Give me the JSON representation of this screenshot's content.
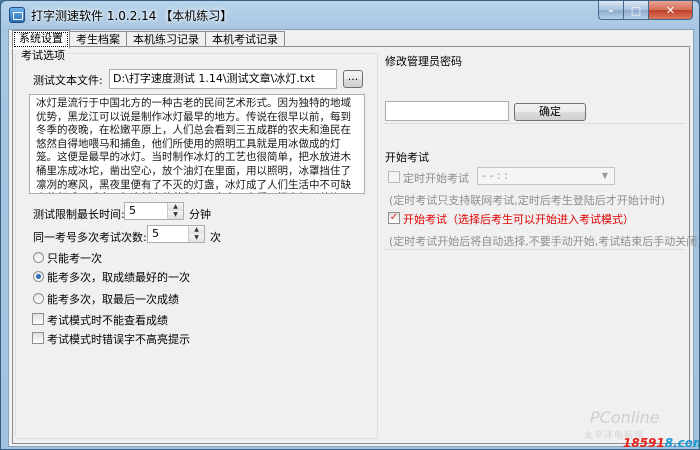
{
  "window": {
    "title": "打字测速软件  1.0.2.14 【本机练习】",
    "minimize": "–",
    "maximize": "□",
    "close": "✕",
    "icon": "app-keyboard-icon"
  },
  "tabs": [
    {
      "label": "系统设置",
      "active": true
    },
    {
      "label": "考生档案",
      "active": false
    },
    {
      "label": "本机练习记录",
      "active": false
    },
    {
      "label": "本机考试记录",
      "active": false
    }
  ],
  "exam_options": {
    "group_title": "考试选项",
    "file_label": "测试文本文件:",
    "file_value": "D:\\打字速度测试 1.14\\测试文章\\冰灯.txt",
    "browse_label": "...",
    "article_text": "冰灯是流行于中国北方的一种古老的民间艺术形式。因为独特的地域优势，黑龙江可以说是制作冰灯最早的地方。传说在很早以前，每到冬季的夜晚，在松嫩平原上，人们总会看到三五成群的农夫和渔民在悠然自得地喂马和捕鱼，他们所使用的照明工具就是用冰做成的灯笼。这便是最早的冰灯。当时制作冰灯的工艺也很简单，把水放进木桶里冻成冰坨，凿出空心，放个油灯在里面，用以照明，冰罩挡住了凛冽的寒风，黑夜里便有了不灭的灯盏，冰灯成了人们生活中不可缺少的帮手。后来，每逢新春佳节和上元之夜，人们又把它加以装饰，而成为供人观赏的独特的艺术表现形",
    "time_limit_label": "测试限制最长时间:",
    "time_limit_value": "5",
    "time_limit_unit": "分钟",
    "retry_label": "同一考号多次考试次数:",
    "retry_value": "5",
    "retry_unit": "次",
    "radio_options": [
      {
        "label": "只能考一次",
        "checked": false
      },
      {
        "label": "能考多次，取成绩最好的一次",
        "checked": true
      },
      {
        "label": "能考多次，取最后一次成绩",
        "checked": false
      }
    ],
    "checkboxes": [
      {
        "label": "考试模式时不能查看成绩",
        "checked": false
      },
      {
        "label": "考试模式时错误字不高亮提示",
        "checked": false
      }
    ]
  },
  "admin_password": {
    "group_title": "修改管理员密码",
    "input_value": "",
    "confirm_label": "确定"
  },
  "start_exam": {
    "group_title": "开始考试",
    "timed_start_label": "定时开始考试",
    "timed_start_checked": false,
    "time_value": "-   -   :  :",
    "timed_note": "(定时考试只支持联网考试,定时后考生登陆后才开始计时)",
    "start_label": "开始考试（选择后考生可以开始进入考试模式）",
    "start_checked": true,
    "start_note": "(定时考试开始后将自动选择,不要手动开始,考试结束后手动关闭)"
  },
  "watermark": {
    "line1": "PConline",
    "line2": "太平洋电脑网"
  },
  "site_stamp": {
    "part1": "18591",
    "part2": "8.com"
  },
  "colors": {
    "accent_red": "#e00000",
    "title_bar": "#a7c6e2"
  }
}
